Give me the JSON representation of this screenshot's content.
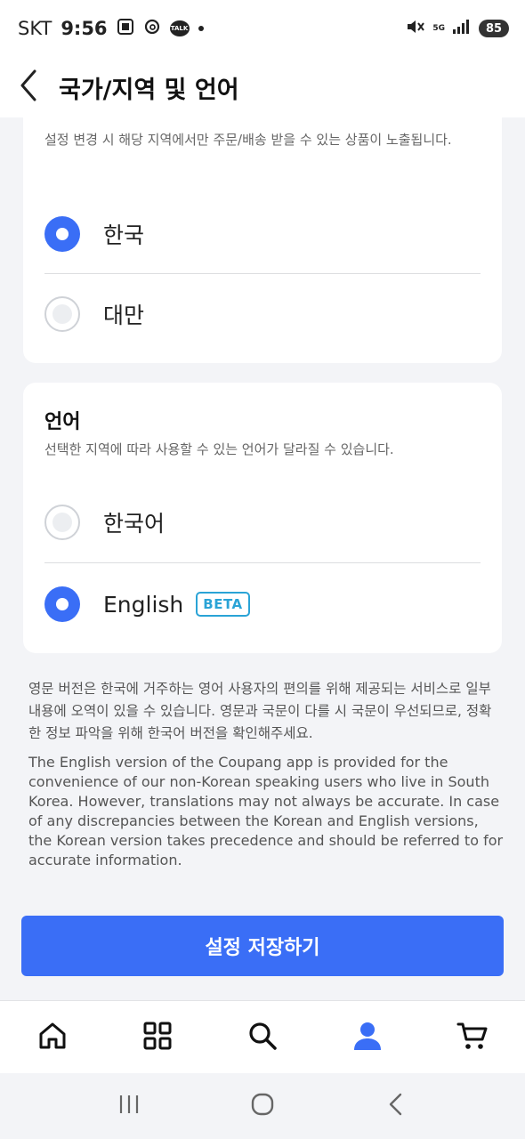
{
  "status_bar": {
    "carrier": "SKT",
    "time": "9:56",
    "network": "5G",
    "battery": "85"
  },
  "header": {
    "title": "국가/지역 및 언어"
  },
  "region": {
    "description": "설정 변경 시 해당 지역에서만 주문/배송 받을 수 있는 상품이 노출됩니다.",
    "options": [
      {
        "label": "한국",
        "selected": true
      },
      {
        "label": "대만",
        "selected": false
      }
    ]
  },
  "language": {
    "heading": "언어",
    "description": "선택한 지역에 따라 사용할 수 있는 언어가 달라질 수 있습니다.",
    "options": [
      {
        "label": "한국어",
        "selected": false
      },
      {
        "label": "English",
        "selected": true,
        "badge": "BETA"
      }
    ]
  },
  "notice": {
    "korean": "영문 버전은 한국에 거주하는 영어 사용자의 편의를 위해 제공되는 서비스로 일부 내용에 오역이 있을 수 있습니다. 영문과 국문이 다를 시 국문이 우선되므로, 정확한 정보 파악을 위해 한국어 버전을 확인해주세요.",
    "english": "The English version of the Coupang app is provided for the convenience of our non-Korean speaking users who live in South Korea. However, translations may not always be accurate. In case of any discrepancies between the Korean and English versions, the Korean version takes precedence and should be referred to for accurate information."
  },
  "save_button": {
    "label": "설정 저장하기"
  },
  "bottom_nav": {
    "items": [
      {
        "icon": "home-icon"
      },
      {
        "icon": "grid-icon"
      },
      {
        "icon": "search-icon"
      },
      {
        "icon": "profile-icon",
        "active": true
      },
      {
        "icon": "cart-icon"
      }
    ]
  },
  "colors": {
    "accent": "#3a6ef6",
    "badge": "#2aa3d6",
    "background": "#f3f4f7"
  }
}
